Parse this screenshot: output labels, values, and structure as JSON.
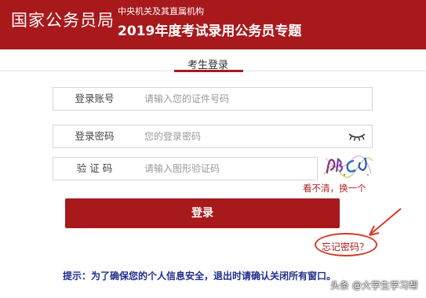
{
  "header": {
    "brand": "国家公务员局",
    "subtitle": "中央机关及其直属机构",
    "title": "2019年度考试录用公务员专题"
  },
  "tabs": {
    "login": "考生登录"
  },
  "form": {
    "account": {
      "label": "登录账号",
      "placeholder": "请输入您的证件号码"
    },
    "password": {
      "label": "登录密码",
      "placeholder": "您的登录密码"
    },
    "captcha": {
      "label": "验 证 码",
      "placeholder": "请输入图形验证码"
    },
    "refresh_link": "看不清，换一个",
    "login_button": "登录",
    "forgot_link": "忘记密码？"
  },
  "notice": "提示：为了确保您的个人信息安全，退出时请确认关闭所有窗口。",
  "watermark": "头条 @大学生学习帮",
  "colors": {
    "brand": "#a8191c",
    "notice": "#1f2f8c",
    "annotation": "#d43a2a"
  },
  "icons": {
    "password_toggle": "eye-closed-icon",
    "captcha": "captcha-image-icon"
  }
}
